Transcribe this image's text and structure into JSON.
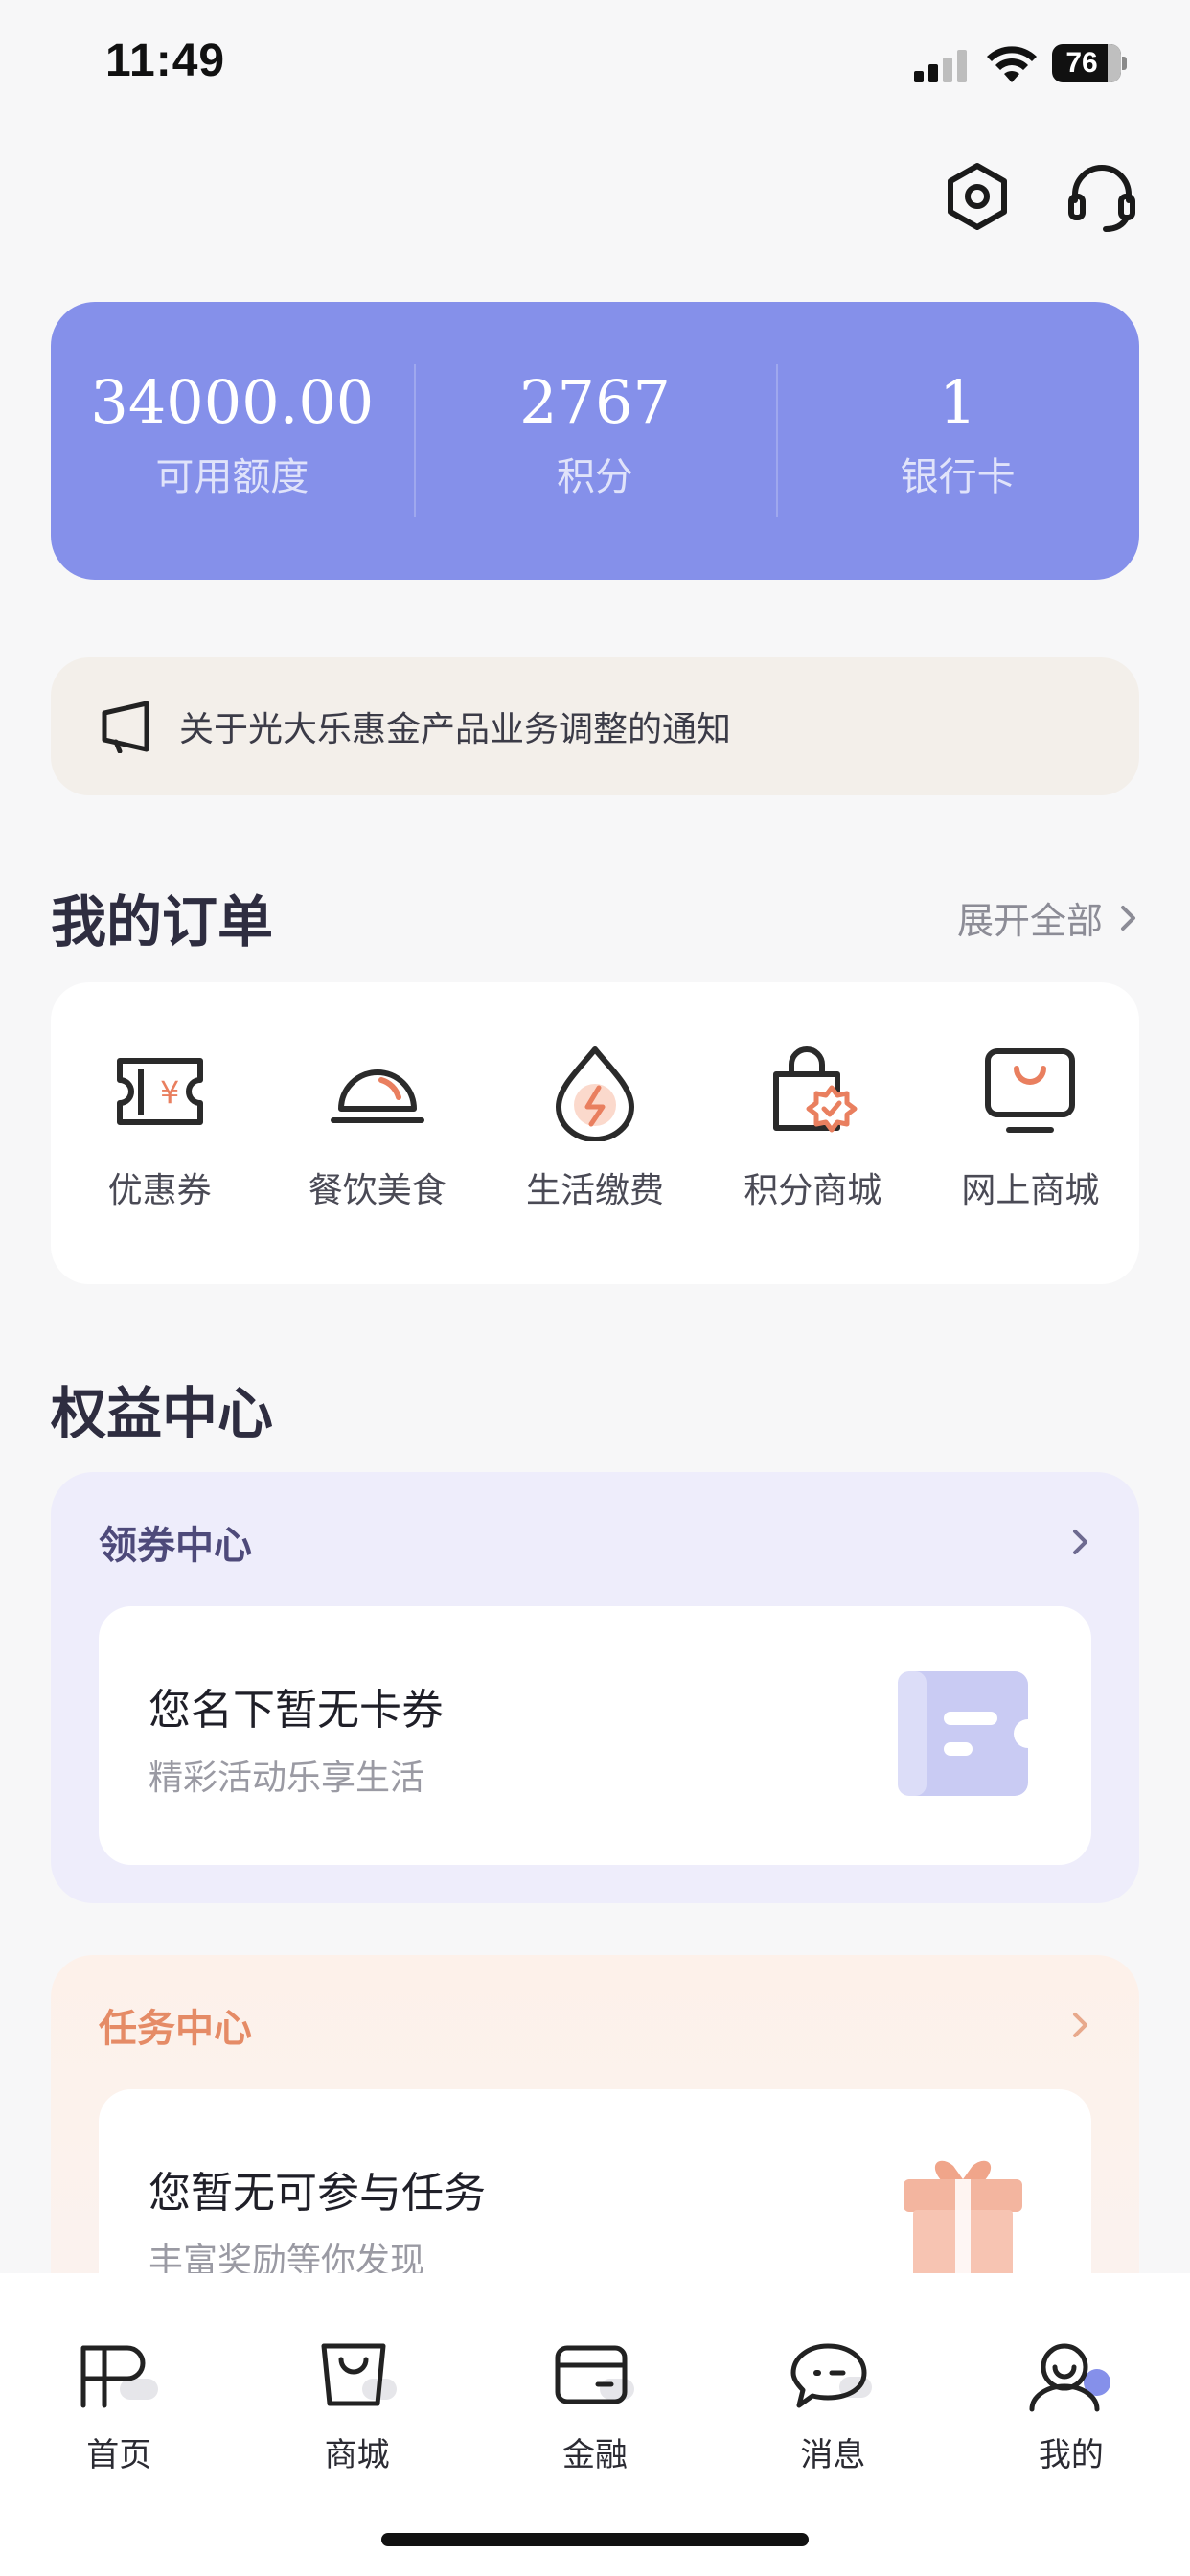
{
  "status_bar": {
    "time": "11:49",
    "battery": "76"
  },
  "header": {
    "settings_icon": "settings-hexagon-icon",
    "service_icon": "headset-icon"
  },
  "stats": [
    {
      "value": "34000.00",
      "label": "可用额度"
    },
    {
      "value": "2767",
      "label": "积分"
    },
    {
      "value": "1",
      "label": "银行卡"
    }
  ],
  "notice": {
    "text": "关于光大乐惠金产品业务调整的通知",
    "icon": "megaphone-icon"
  },
  "orders": {
    "title": "我的订单",
    "expand_label": "展开全部",
    "items": [
      {
        "label": "优惠券",
        "icon": "coupon-icon"
      },
      {
        "label": "餐饮美食",
        "icon": "food-cloche-icon"
      },
      {
        "label": "生活缴费",
        "icon": "utility-drop-icon"
      },
      {
        "label": "积分商城",
        "icon": "points-bag-icon"
      },
      {
        "label": "网上商城",
        "icon": "online-store-icon"
      }
    ]
  },
  "rights": {
    "title": "权益中心",
    "coupon_center": {
      "title": "领券中心",
      "empty_title": "您名下暂无卡券",
      "empty_subtitle": "精彩活动乐享生活"
    },
    "task_center": {
      "title": "任务中心",
      "empty_title": "您暂无可参与任务",
      "empty_subtitle": "丰富奖励等你发现"
    }
  },
  "tabbar": [
    {
      "label": "首页",
      "icon": "home-icon"
    },
    {
      "label": "商城",
      "icon": "mall-icon"
    },
    {
      "label": "金融",
      "icon": "finance-card-icon"
    },
    {
      "label": "消息",
      "icon": "message-icon"
    },
    {
      "label": "我的",
      "icon": "profile-icon",
      "active": true
    }
  ],
  "colors": {
    "accent": "#8590ea",
    "orange": "#e97f5f",
    "coupon_bg": "#eeedfb",
    "task_title": "#e58b66"
  }
}
